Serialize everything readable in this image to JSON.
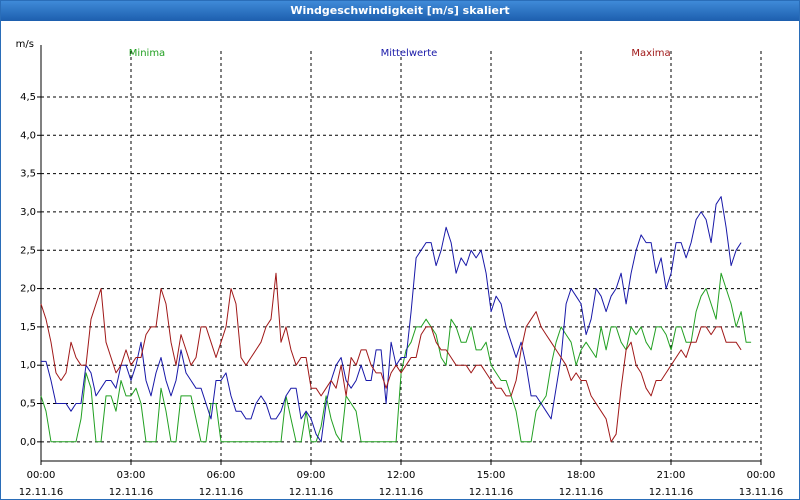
{
  "window": {
    "title": "Windgeschwindigkeit [m/s] skaliert"
  },
  "chart_data": {
    "type": "line",
    "title": "Windgeschwindigkeit [m/s] skaliert",
    "ylabel": "m/s",
    "xlabel": "",
    "ylim": [
      -0.25,
      5.1
    ],
    "xlim": [
      0,
      24
    ],
    "grid": true,
    "legend_placement": "top",
    "y_ticks": [
      {
        "value": 0.0,
        "label": "0,0"
      },
      {
        "value": 0.5,
        "label": "0,5"
      },
      {
        "value": 1.0,
        "label": "1,0"
      },
      {
        "value": 1.5,
        "label": "1,5"
      },
      {
        "value": 2.0,
        "label": "2,0"
      },
      {
        "value": 2.5,
        "label": "2,5"
      },
      {
        "value": 3.0,
        "label": "3,0"
      },
      {
        "value": 3.5,
        "label": "3,5"
      },
      {
        "value": 4.0,
        "label": "4,0"
      },
      {
        "value": 4.5,
        "label": "4,5"
      }
    ],
    "x_ticks": [
      {
        "value": 0,
        "time": "00:00",
        "date": "12.11.16"
      },
      {
        "value": 3,
        "time": "03:00",
        "date": "12.11.16"
      },
      {
        "value": 6,
        "time": "06:00",
        "date": "12.11.16"
      },
      {
        "value": 9,
        "time": "09:00",
        "date": "12.11.16"
      },
      {
        "value": 12,
        "time": "12:00",
        "date": "12.11.16"
      },
      {
        "value": 15,
        "time": "15:00",
        "date": "12.11.16"
      },
      {
        "value": 18,
        "time": "18:00",
        "date": "12.11.16"
      },
      {
        "value": 21,
        "time": "21:00",
        "date": "12.11.16"
      },
      {
        "value": 24,
        "time": "00:00",
        "date": "13.11.16"
      }
    ],
    "x_step_hours": 0.1667,
    "series": [
      {
        "name": "Minima",
        "color": "#22a022",
        "values": [
          0.6,
          0.4,
          0.0,
          0.0,
          0.0,
          0.0,
          0.0,
          0.0,
          0.3,
          0.9,
          0.7,
          0.0,
          0.0,
          0.6,
          0.6,
          0.4,
          0.8,
          0.6,
          0.6,
          0.7,
          0.5,
          0.0,
          0.0,
          0.0,
          0.7,
          0.4,
          0.0,
          0.0,
          0.6,
          0.6,
          0.6,
          0.3,
          0.0,
          0.0,
          0.5,
          0.5,
          0.0,
          0.0,
          0.0,
          0.0,
          0.0,
          0.0,
          0.0,
          0.0,
          0.0,
          0.0,
          0.0,
          0.0,
          0.0,
          0.6,
          0.3,
          0.0,
          0.0,
          0.4,
          0.0,
          0.0,
          0.2,
          0.6,
          0.3,
          0.1,
          0.0,
          0.6,
          0.5,
          0.4,
          0.0,
          0.0,
          0.0,
          0.0,
          0.0,
          0.0,
          0.0,
          0.0,
          0.9,
          1.2,
          1.3,
          1.5,
          1.5,
          1.6,
          1.5,
          1.4,
          1.1,
          1.0,
          1.6,
          1.5,
          1.3,
          1.3,
          1.5,
          1.2,
          1.2,
          1.3,
          1.0,
          0.9,
          0.8,
          0.8,
          0.6,
          0.4,
          0.0,
          0.0,
          0.0,
          0.4,
          0.5,
          0.6,
          1.0,
          1.3,
          1.5,
          1.4,
          1.3,
          1.0,
          1.2,
          1.3,
          1.2,
          1.1,
          1.5,
          1.2,
          1.5,
          1.5,
          1.3,
          1.2,
          1.5,
          1.4,
          1.5,
          1.3,
          1.2,
          1.5,
          1.5,
          1.4,
          1.2,
          1.5,
          1.5,
          1.3,
          1.3,
          1.7,
          1.9,
          2.0,
          1.8,
          1.6,
          2.2,
          2.0,
          1.8,
          1.5,
          1.7,
          1.3,
          1.3
        ]
      },
      {
        "name": "Mittelwerte",
        "color": "#1818a8",
        "values": [
          1.05,
          1.05,
          0.8,
          0.5,
          0.5,
          0.5,
          0.4,
          0.5,
          0.5,
          1.0,
          0.9,
          0.6,
          0.7,
          0.8,
          0.8,
          0.7,
          1.0,
          1.0,
          0.8,
          1.0,
          1.3,
          0.8,
          0.6,
          0.9,
          1.1,
          0.8,
          0.6,
          0.8,
          1.2,
          0.9,
          0.8,
          0.7,
          0.7,
          0.5,
          0.3,
          0.8,
          0.8,
          0.9,
          0.6,
          0.4,
          0.4,
          0.3,
          0.3,
          0.5,
          0.6,
          0.5,
          0.3,
          0.3,
          0.4,
          0.6,
          0.7,
          0.7,
          0.3,
          0.4,
          0.3,
          0.1,
          0.0,
          0.5,
          0.8,
          1.0,
          1.1,
          0.8,
          0.7,
          0.8,
          1.0,
          0.8,
          0.8,
          1.2,
          1.2,
          0.5,
          1.3,
          1.0,
          1.1,
          1.1,
          1.7,
          2.4,
          2.5,
          2.6,
          2.6,
          2.3,
          2.5,
          2.8,
          2.6,
          2.2,
          2.4,
          2.3,
          2.5,
          2.4,
          2.5,
          2.2,
          1.7,
          1.9,
          1.8,
          1.5,
          1.3,
          1.1,
          1.3,
          1.0,
          0.6,
          0.6,
          0.5,
          0.4,
          0.3,
          0.7,
          1.1,
          1.8,
          2.0,
          1.9,
          1.8,
          1.4,
          1.6,
          2.0,
          1.9,
          1.7,
          1.9,
          2.0,
          2.2,
          1.8,
          2.2,
          2.5,
          2.7,
          2.6,
          2.6,
          2.2,
          2.4,
          2.0,
          2.2,
          2.6,
          2.6,
          2.4,
          2.6,
          2.9,
          3.0,
          2.9,
          2.6,
          3.1,
          3.2,
          2.8,
          2.3,
          2.5,
          2.6
        ]
      },
      {
        "name": "Maxima",
        "color": "#a01818",
        "values": [
          1.8,
          1.6,
          1.3,
          0.9,
          0.8,
          0.9,
          1.3,
          1.1,
          1.0,
          1.0,
          1.6,
          1.8,
          2.0,
          1.3,
          1.1,
          0.9,
          1.0,
          1.2,
          1.0,
          1.1,
          1.1,
          1.4,
          1.5,
          1.5,
          2.0,
          1.8,
          1.3,
          1.0,
          1.4,
          1.2,
          1.0,
          1.1,
          1.5,
          1.5,
          1.3,
          1.1,
          1.3,
          1.5,
          2.0,
          1.8,
          1.1,
          1.0,
          1.1,
          1.2,
          1.3,
          1.5,
          1.6,
          2.2,
          1.3,
          1.5,
          1.2,
          1.0,
          1.1,
          1.1,
          0.7,
          0.7,
          0.6,
          0.7,
          0.8,
          0.7,
          1.0,
          0.6,
          1.1,
          1.0,
          1.2,
          1.2,
          1.0,
          0.9,
          0.9,
          0.7,
          0.9,
          1.0,
          0.9,
          1.0,
          1.1,
          1.1,
          1.4,
          1.5,
          1.5,
          1.3,
          1.2,
          1.2,
          1.1,
          1.0,
          1.0,
          1.0,
          0.9,
          1.0,
          1.0,
          0.9,
          0.8,
          0.7,
          0.7,
          0.6,
          0.6,
          0.8,
          1.2,
          1.5,
          1.6,
          1.7,
          1.5,
          1.4,
          1.3,
          1.2,
          1.1,
          1.0,
          0.8,
          0.9,
          0.8,
          0.8,
          0.6,
          0.5,
          0.4,
          0.3,
          0.0,
          0.1,
          0.7,
          1.2,
          1.3,
          1.0,
          0.9,
          0.7,
          0.6,
          0.8,
          0.8,
          0.9,
          1.0,
          1.1,
          1.2,
          1.1,
          1.3,
          1.3,
          1.5,
          1.5,
          1.4,
          1.5,
          1.5,
          1.3,
          1.3,
          1.3,
          1.2
        ]
      }
    ]
  }
}
